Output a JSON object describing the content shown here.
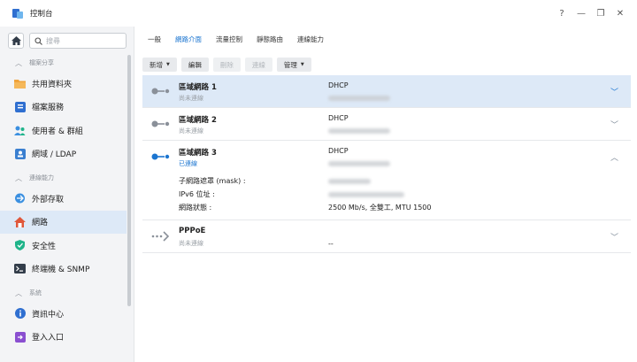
{
  "window": {
    "title": "控制台",
    "controls": [
      "?",
      "—",
      "❐",
      "✕"
    ]
  },
  "sidebar": {
    "search_placeholder": "搜尋",
    "sections": [
      {
        "title": "檔案分享",
        "items": [
          {
            "label": "共用資料夾",
            "icon": "folder-icon",
            "color": "#f0a33a"
          },
          {
            "label": "檔案服務",
            "icon": "file-services-icon",
            "color": "#2f6fd0"
          },
          {
            "label": "使用者 & 群組",
            "icon": "users-icon",
            "color": "#3a8fe0"
          },
          {
            "label": "網域 / LDAP",
            "icon": "domain-icon",
            "color": "#3a7fd0"
          }
        ]
      },
      {
        "title": "連線能力",
        "items": [
          {
            "label": "外部存取",
            "icon": "external-access-icon",
            "color": "#3a8fe0"
          },
          {
            "label": "網路",
            "icon": "network-house-icon",
            "color": "#e0573a",
            "active": true
          },
          {
            "label": "安全性",
            "icon": "shield-icon",
            "color": "#1fb48a"
          },
          {
            "label": "終端機 & SNMP",
            "icon": "terminal-icon",
            "color": "#333d4a"
          }
        ]
      },
      {
        "title": "系統",
        "items": [
          {
            "label": "資訊中心",
            "icon": "info-icon",
            "color": "#2f6fd0"
          },
          {
            "label": "登入入口",
            "icon": "login-portal-icon",
            "color": "#8a4fd0"
          }
        ]
      }
    ]
  },
  "tabs": [
    "一般",
    "網路介面",
    "流量控制",
    "靜態路由",
    "連線能力"
  ],
  "active_tab": 1,
  "toolbar": {
    "create": "新增",
    "edit": "編輯",
    "delete": "刪除",
    "connect": "連線",
    "manage": "管理"
  },
  "interfaces": [
    {
      "name": "區域網路 1",
      "status": "尚未連線",
      "mode": "DHCP",
      "selected": true,
      "expanded": false
    },
    {
      "name": "區域網路 2",
      "status": "尚未連線",
      "mode": "DHCP",
      "selected": false,
      "expanded": false
    },
    {
      "name": "區域網路 3",
      "status": "已連線",
      "mode": "DHCP",
      "selected": false,
      "expanded": true,
      "details": [
        {
          "label": "子網路遮罩 (mask) :",
          "value": ""
        },
        {
          "label": "IPv6 位址 :",
          "value": ""
        },
        {
          "label": "網路狀態 :",
          "value": "2500 Mb/s, 全雙工, MTU 1500"
        }
      ]
    },
    {
      "name": "PPPoE",
      "status": "尚未連線",
      "mode": "--",
      "selected": false,
      "expanded": false
    }
  ],
  "colors": {
    "accent": "#1b75d0",
    "selected_bg": "#dde9f7"
  }
}
